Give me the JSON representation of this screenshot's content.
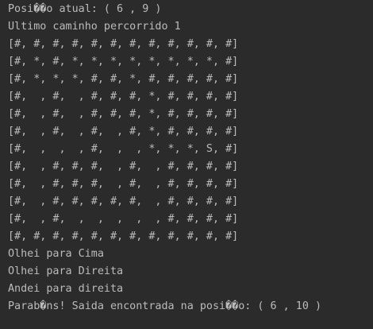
{
  "console": {
    "lines": [
      "Posi��o atual: ( 6 , 9 )",
      "Ultimo caminho percorrido 1",
      "[#, #, #, #, #, #, #, #, #, #, #, #]",
      "[#, *, #, *, *, *, *, *, *, *, *, #]",
      "[#, *, *, *, #, #, *, #, #, #, #, #]",
      "[#,  , #,  , #, #, #, *, #, #, #, #]",
      "[#,  , #,  , #, #, #, *, #, #, #, #]",
      "[#,  , #,  , #,  , #, *, #, #, #, #]",
      "[#,  ,  ,  , #,  ,  , *, *, *, S, #]",
      "[#,  , #, #, #,  , #,  , #, #, #, #]",
      "[#,  , #, #, #,  , #,  , #, #, #, #]",
      "[#,  , #, #, #, #, #,  , #, #, #, #]",
      "[#,  , #,  ,  ,  ,  ,  , #, #, #, #]",
      "[#, #, #, #, #, #, #, #, #, #, #, #]",
      "Olhei para Cima",
      "Olhei para Direita",
      "Andei para direita",
      "Parab�ns! Saida encontrada na posi��o: ( 6 , 10 )"
    ]
  }
}
